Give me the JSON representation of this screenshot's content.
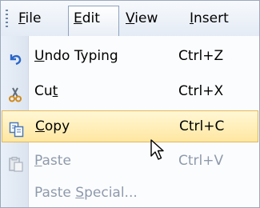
{
  "menubar": {
    "items": [
      {
        "pre": "",
        "mnemonic": "F",
        "post": "ile"
      },
      {
        "pre": "",
        "mnemonic": "E",
        "post": "dit"
      },
      {
        "pre": "",
        "mnemonic": "V",
        "post": "iew"
      },
      {
        "pre": "",
        "mnemonic": "I",
        "post": "nsert"
      }
    ],
    "active_item": "Edit"
  },
  "edit_menu": {
    "items": [
      {
        "pre": "",
        "mnemonic": "U",
        "post": "ndo Typing",
        "shortcut": "Ctrl+Z",
        "icon": "undo-icon",
        "enabled": true
      },
      {
        "pre": "Cu",
        "mnemonic": "t",
        "post": "",
        "shortcut": "Ctrl+X",
        "icon": "scissors-icon",
        "enabled": true
      },
      {
        "pre": "",
        "mnemonic": "C",
        "post": "opy",
        "shortcut": "Ctrl+C",
        "icon": "copy-icon",
        "enabled": true,
        "highlighted": true
      },
      {
        "pre": "",
        "mnemonic": "P",
        "post": "aste",
        "shortcut": "Ctrl+V",
        "icon": "paste-icon",
        "enabled": false
      },
      {
        "pre": "Paste ",
        "mnemonic": "S",
        "post": "pecial...",
        "shortcut": "",
        "icon": "",
        "enabled": false
      }
    ]
  },
  "colors": {
    "highlight_fill": "#ffe7a2",
    "highlight_border": "#e2b65a",
    "disabled_text": "#8e9aab"
  }
}
